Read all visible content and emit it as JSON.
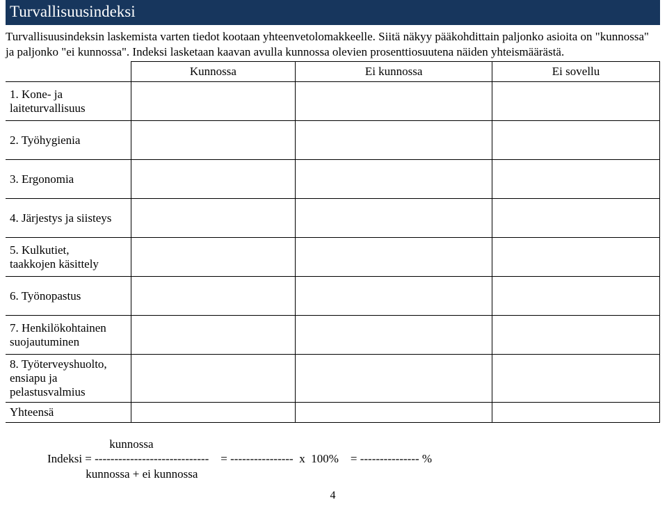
{
  "title": "Turvallisuusindeksi",
  "intro_line1": "Turvallisuusindeksin laskemista varten tiedot kootaan yhteenvetolomakkeelle. Siitä näkyy pääkohdittain paljonko asioita on \"kunnossa\" ja paljonko \"ei kunnossa\". Indeksi lasketaan kaavan avulla kunnossa olevien prosenttiosuutena näiden yhteismäärästä.",
  "columns": {
    "c1": "Kunnossa",
    "c2": "Ei kunnossa",
    "c3": "Ei sovellu"
  },
  "rows": [
    {
      "label": "1. Kone- ja laiteturvallisuus"
    },
    {
      "label": "2. Työhygienia"
    },
    {
      "label": "3. Ergonomia"
    },
    {
      "label": "4. Järjestys ja siisteys"
    },
    {
      "label": "5. Kulkutiet,\n    taakkojen käsittely"
    },
    {
      "label": "6. Työnopastus"
    },
    {
      "label": "7. Henkilökohtainen\n    suojautuminen"
    },
    {
      "label": "8. Työterveyshuolto,\n    ensiapu ja\n    pelastusvalmius"
    }
  ],
  "totals_label": "Yhteensä",
  "formula": {
    "top": "                     kunnossa",
    "mid": "Indeksi = -----------------------------    = ----------------  x  100%    = --------------- %",
    "bottom": "             kunnossa + ei kunnossa"
  },
  "page_number": "4"
}
